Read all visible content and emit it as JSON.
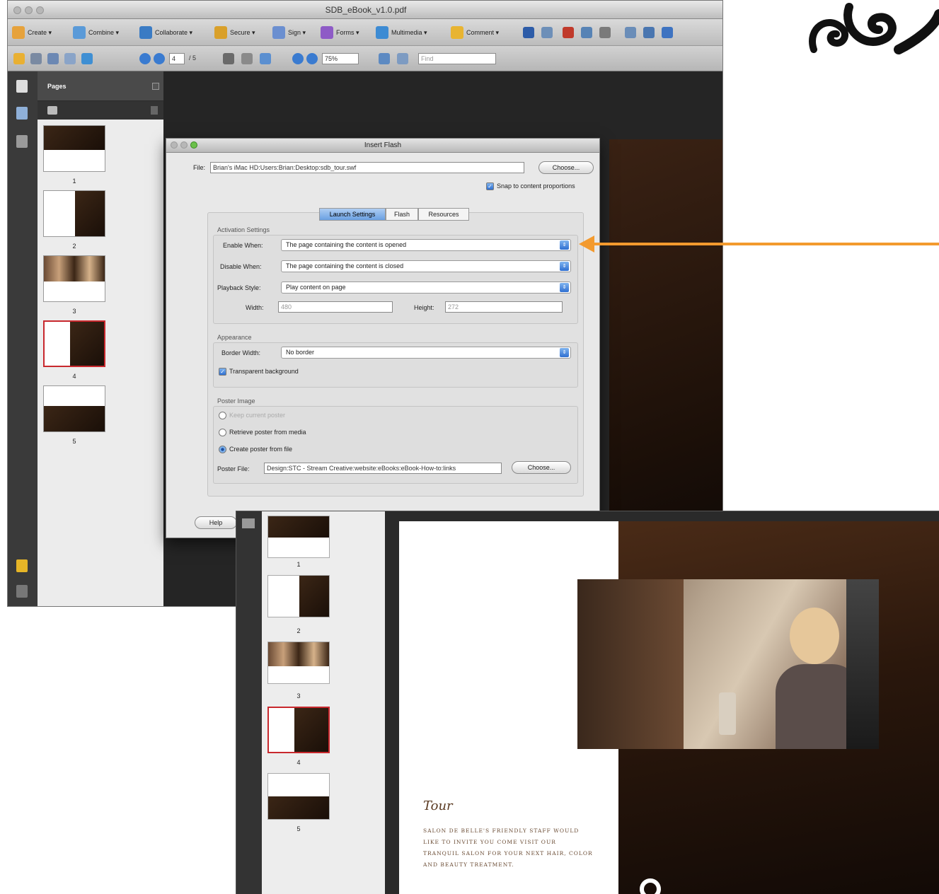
{
  "window": {
    "title": "SDB_eBook_v1.0.pdf",
    "toolbar_top": [
      {
        "label": "Create",
        "icon": "create-icon"
      },
      {
        "label": "Combine",
        "icon": "combine-icon"
      },
      {
        "label": "Collaborate",
        "icon": "collaborate-icon"
      },
      {
        "label": "Secure",
        "icon": "lock-icon"
      },
      {
        "label": "Sign",
        "icon": "pen-icon"
      },
      {
        "label": "Forms",
        "icon": "forms-icon"
      },
      {
        "label": "Multimedia",
        "icon": "film-icon"
      },
      {
        "label": "Comment",
        "icon": "comment-icon"
      }
    ],
    "page_current": "4",
    "page_total": "/ 5",
    "zoom": "75%",
    "find_placeholder": "Find"
  },
  "pages_panel": {
    "title": "Pages",
    "thumbnails": [
      "1",
      "2",
      "3",
      "4",
      "5"
    ],
    "selected": "4"
  },
  "dialog": {
    "title": "Insert Flash",
    "file_label": "File:",
    "file_value": "Brian's iMac HD:Users:Brian:Desktop:sdb_tour.swf",
    "choose_label": "Choose...",
    "snap_label": "Snap to content proportions",
    "tabs": [
      "Launch Settings",
      "Flash",
      "Resources"
    ],
    "active_tab": "Launch Settings",
    "activation_heading": "Activation Settings",
    "enable_label": "Enable When:",
    "enable_value": "The page containing the content is opened",
    "disable_label": "Disable When:",
    "disable_value": "The page containing the content is closed",
    "playback_label": "Playback Style:",
    "playback_value": "Play content on page",
    "width_label": "Width:",
    "width_value": "480",
    "height_label": "Height:",
    "height_value": "272",
    "appearance_heading": "Appearance",
    "border_label": "Border Width:",
    "border_value": "No border",
    "transparent_label": "Transparent background",
    "poster_heading": "Poster Image",
    "poster_opt1": "Keep current poster",
    "poster_opt2": "Retrieve poster from media",
    "poster_opt3": "Create poster from file",
    "poster_file_label": "Poster File:",
    "poster_file_value": "Design:STC - Stream Creative:website:eBooks:eBook-How-to:links",
    "poster_choose_label": "Choose...",
    "help_label": "Help"
  },
  "front": {
    "thumbnails": [
      "1",
      "2",
      "3",
      "4",
      "5"
    ],
    "tour_title": "Tour",
    "tour_text": "Salon de Belle's friendly staff would like to invite you come visit our tranquil salon for your next hair, color and beauty treatment."
  },
  "colors": {
    "arrow": "#f39a2e",
    "selection": "#c8282d",
    "page_brown": "#2a170c"
  }
}
